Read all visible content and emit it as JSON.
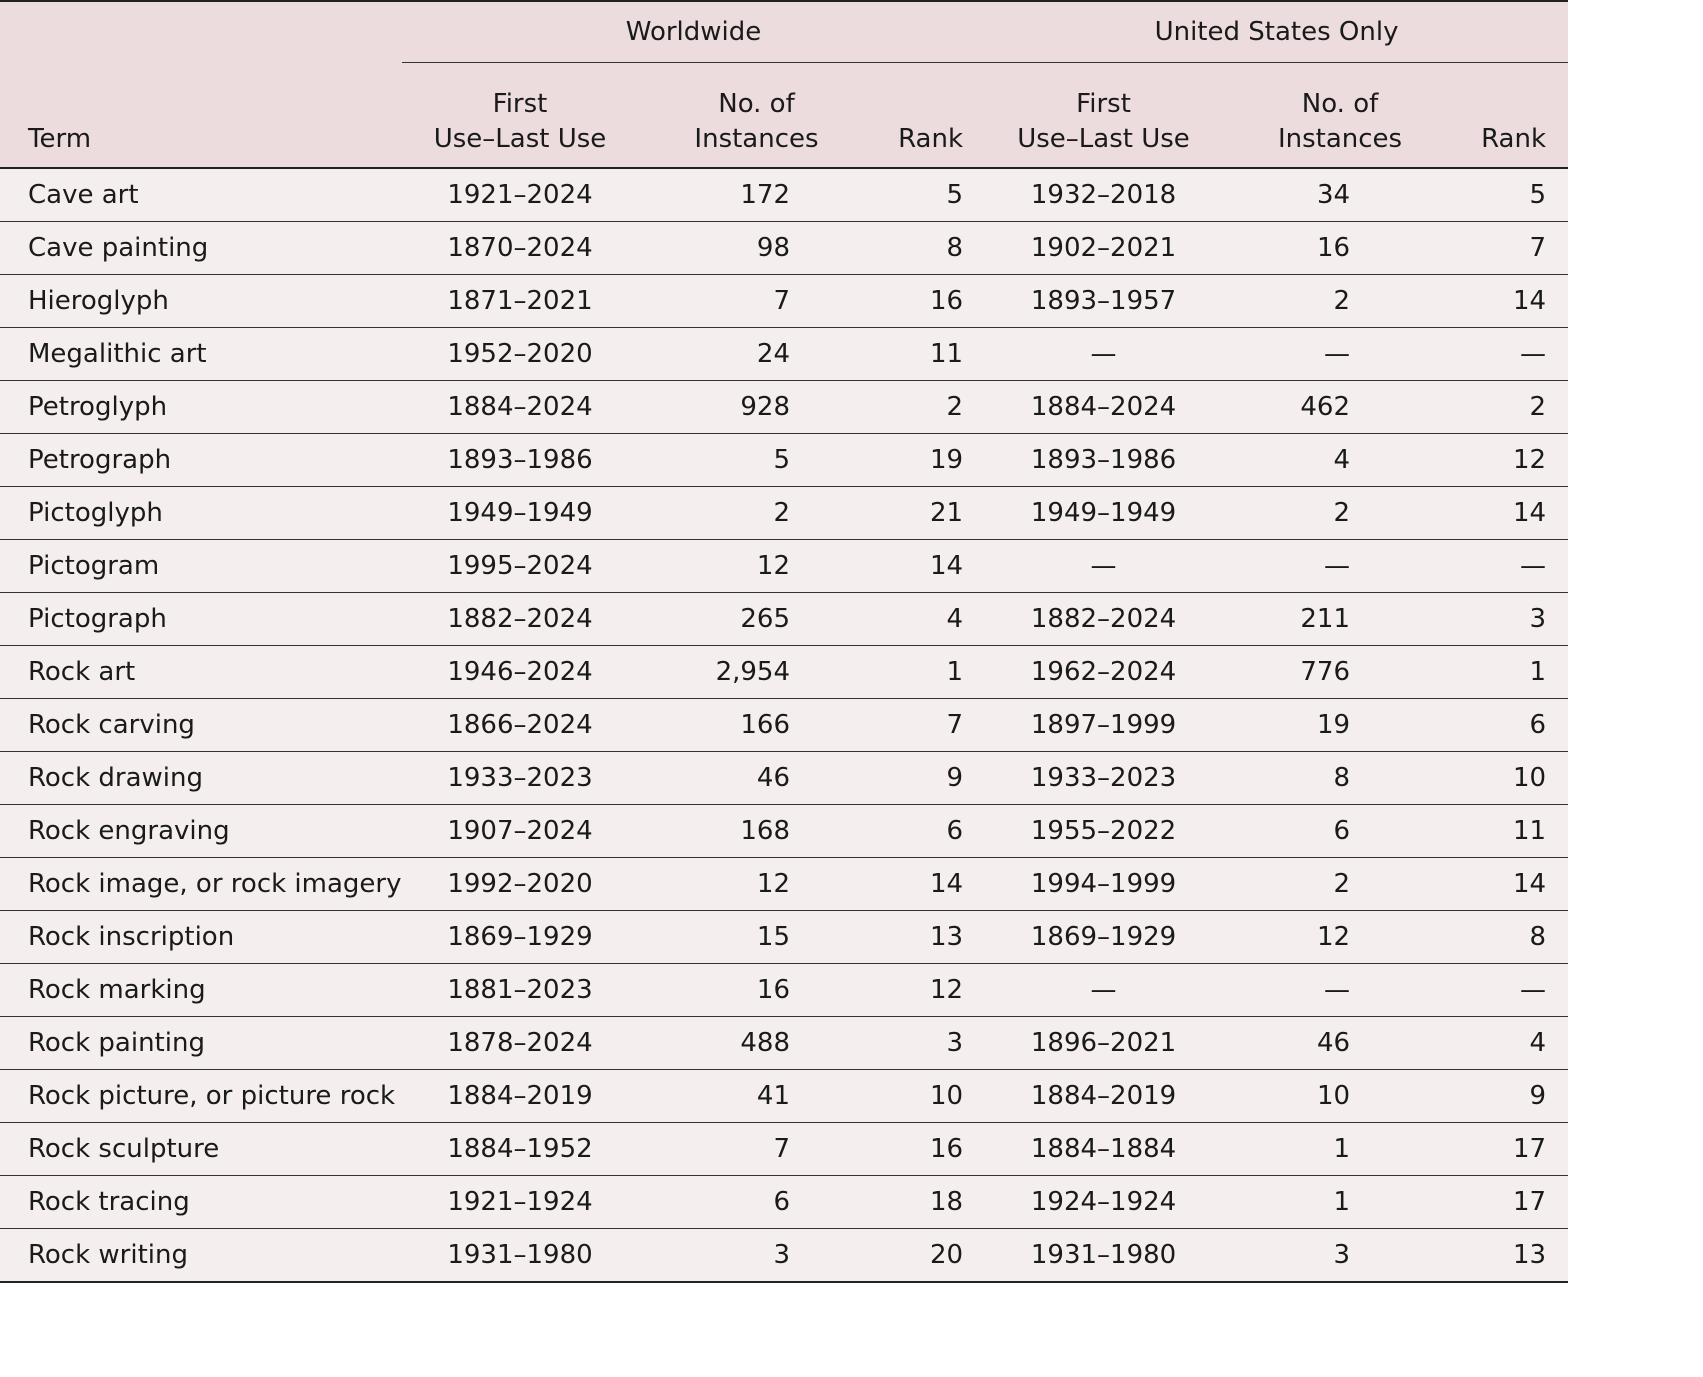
{
  "header": {
    "term": "Term",
    "groups": [
      "Worldwide",
      "United States Only"
    ],
    "first_use_line1": "First",
    "first_use_line2": "Use–Last Use",
    "instances_line1": "No. of",
    "instances_line2": "Instances",
    "rank": "Rank"
  },
  "rows": [
    [
      "Cave art",
      "1921–2024",
      "172",
      "5",
      "1932–2018",
      "34",
      "5"
    ],
    [
      "Cave painting",
      "1870–2024",
      "98",
      "8",
      "1902–2021",
      "16",
      "7"
    ],
    [
      "Hieroglyph",
      "1871–2021",
      "7",
      "16",
      "1893–1957",
      "2",
      "14"
    ],
    [
      "Megalithic art",
      "1952–2020",
      "24",
      "11",
      "—",
      "—",
      "—"
    ],
    [
      "Petroglyph",
      "1884–2024",
      "928",
      "2",
      "1884–2024",
      "462",
      "2"
    ],
    [
      "Petrograph",
      "1893–1986",
      "5",
      "19",
      "1893–1986",
      "4",
      "12"
    ],
    [
      "Pictoglyph",
      "1949–1949",
      "2",
      "21",
      "1949–1949",
      "2",
      "14"
    ],
    [
      "Pictogram",
      "1995–2024",
      "12",
      "14",
      "—",
      "—",
      "—"
    ],
    [
      "Pictograph",
      "1882–2024",
      "265",
      "4",
      "1882–2024",
      "211",
      "3"
    ],
    [
      "Rock art",
      "1946–2024",
      "2,954",
      "1",
      "1962–2024",
      "776",
      "1"
    ],
    [
      "Rock carving",
      "1866–2024",
      "166",
      "7",
      "1897–1999",
      "19",
      "6"
    ],
    [
      "Rock drawing",
      "1933–2023",
      "46",
      "9",
      "1933–2023",
      "8",
      "10"
    ],
    [
      "Rock engraving",
      "1907–2024",
      "168",
      "6",
      "1955–2022",
      "6",
      "11"
    ],
    [
      "Rock image, or rock imagery",
      "1992–2020",
      "12",
      "14",
      "1994–1999",
      "2",
      "14"
    ],
    [
      "Rock inscription",
      "1869–1929",
      "15",
      "13",
      "1869–1929",
      "12",
      "8"
    ],
    [
      "Rock marking",
      "1881–2023",
      "16",
      "12",
      "—",
      "—",
      "—"
    ],
    [
      "Rock painting",
      "1878–2024",
      "488",
      "3",
      "1896–2021",
      "46",
      "4"
    ],
    [
      "Rock picture, or picture rock",
      "1884–2019",
      "41",
      "10",
      "1884–2019",
      "10",
      "9"
    ],
    [
      "Rock sculpture",
      "1884–1952",
      "7",
      "16",
      "1884–1884",
      "1",
      "17"
    ],
    [
      "Rock tracing",
      "1921–1924",
      "6",
      "18",
      "1924–1924",
      "1",
      "17"
    ],
    [
      "Rock writing",
      "1931–1980",
      "3",
      "20",
      "1931–1980",
      "3",
      "13"
    ]
  ]
}
